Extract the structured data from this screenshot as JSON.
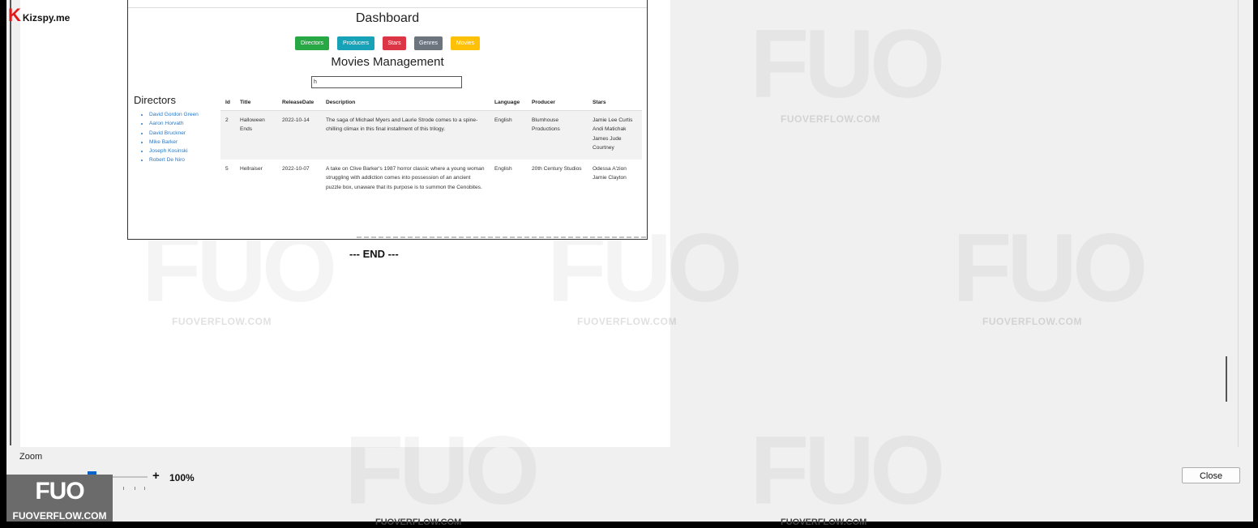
{
  "brand": {
    "mark": "K",
    "name": "Kizspy.me"
  },
  "dashboard": {
    "title": "Dashboard",
    "buttons": [
      {
        "label": "Directors",
        "color": "#28a745"
      },
      {
        "label": "Producers",
        "color": "#17a2b8"
      },
      {
        "label": "Stars",
        "color": "#dc3545"
      },
      {
        "label": "Genres",
        "color": "#6c757d"
      },
      {
        "label": "Movies",
        "color": "#ffc107"
      }
    ],
    "section_title": "Movies Management",
    "search_value": "h",
    "directors": {
      "title": "Directors",
      "items": [
        "David Gordon Green",
        "Aaron Horvath",
        "David Bruckner",
        "Mike Barker",
        "Joseph Kosinski",
        "Robert De Niro"
      ]
    },
    "table": {
      "headers": [
        "Id",
        "Title",
        "ReleaseDate",
        "Description",
        "Language",
        "Producer",
        "Stars"
      ],
      "rows": [
        {
          "id": "2",
          "title": "Halloween Ends",
          "release_date": "2022-10-14",
          "description": "The saga of Michael Myers and Laurie Strode comes to a spine-chilling climax in this final installment of this trilogy.",
          "language": "English",
          "producer": "Blumhouse Productions",
          "stars": [
            "Jamie Lee Curtis",
            "Andi Matichak",
            "James Jude Courtney"
          ]
        },
        {
          "id": "5",
          "title": "Hellraiser",
          "release_date": "2022-10-07",
          "description": "A take on Clive Barker's 1987 horror classic where a young woman struggling with addiction comes into possession of an ancient puzzle box, unaware that its purpose is to summon the Cenobites.",
          "language": "English",
          "producer": "20th Century Studios",
          "stars": [
            "Odessa A'zion",
            "Jamie Clayton"
          ]
        }
      ]
    }
  },
  "end_marker": "--- END ---",
  "zoom": {
    "label": "Zoom",
    "minus": "-",
    "plus": "+",
    "value": "100%",
    "level": 0.5
  },
  "close_button": "Close",
  "watermark": {
    "logo": "FUO",
    "site": "FUOVERFLOW.COM"
  }
}
